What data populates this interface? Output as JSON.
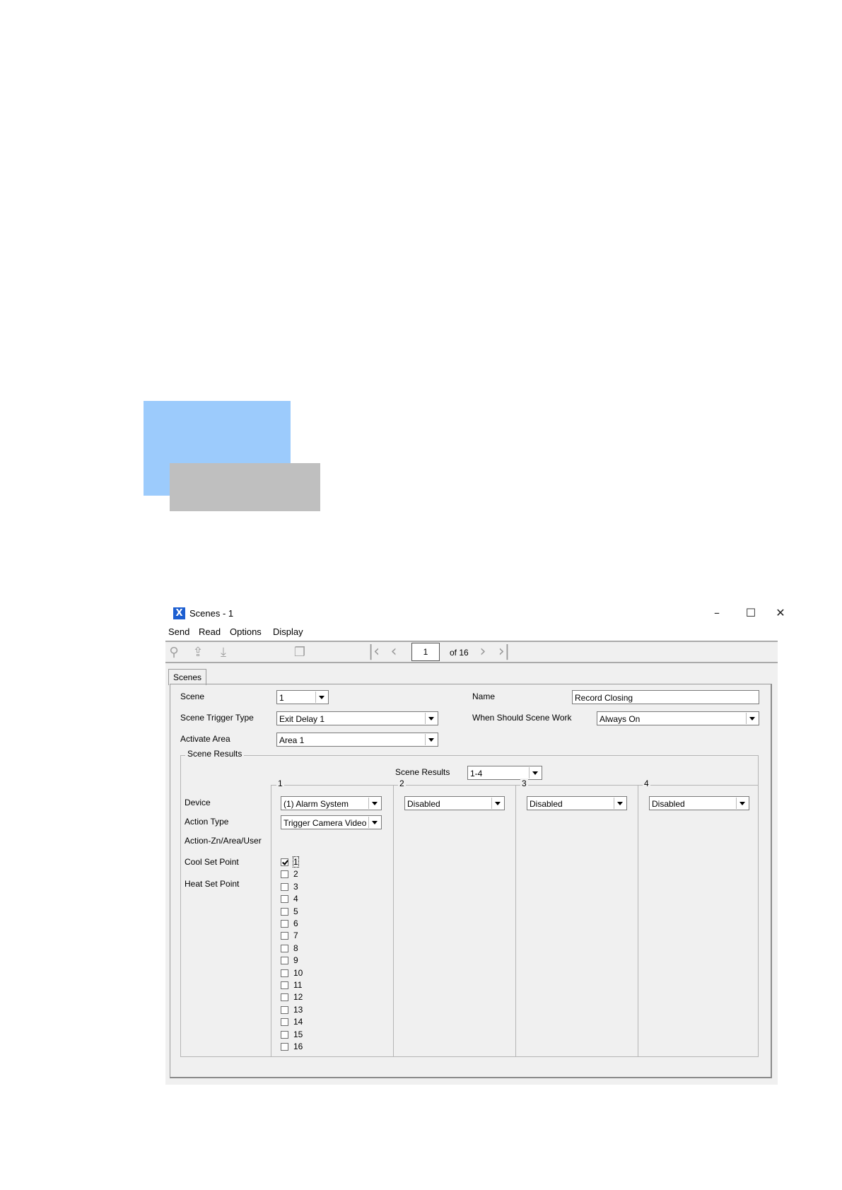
{
  "window": {
    "title": "Scenes - 1",
    "controls": {
      "minimize": "–",
      "maximize": "☐",
      "close": "✕"
    }
  },
  "menu": [
    "Send",
    "Read",
    "Options",
    "Display"
  ],
  "toolbar": {
    "icons": [
      "search-icon",
      "upload-icon",
      "download-icon",
      "copy-icon"
    ],
    "page_current": "1",
    "page_of": "of 16"
  },
  "tab": {
    "label": "Scenes"
  },
  "form": {
    "scene_label": "Scene",
    "scene_value": "1",
    "trigger_label": "Scene Trigger Type",
    "trigger_value": "Exit Delay 1",
    "area_label": "Activate Area",
    "area_value": "Area 1",
    "name_label": "Name",
    "name_value": "Record Closing",
    "when_label": "When Should Scene Work",
    "when_value": "Always On"
  },
  "scene_results": {
    "group_title": "Scene Results",
    "selector_label": "Scene Results",
    "selector_value": "1-4",
    "row_labels": {
      "device": "Device",
      "action_type": "Action Type",
      "action_target": "Action-Zn/Area/User",
      "cool": "Cool Set Point",
      "heat": "Heat Set Point"
    },
    "columns": [
      {
        "number": "1",
        "device": "(1) Alarm System",
        "action_type": "Trigger Camera Video Cl"
      },
      {
        "number": "2",
        "device": "Disabled"
      },
      {
        "number": "3",
        "device": "Disabled"
      },
      {
        "number": "4",
        "device": "Disabled"
      }
    ],
    "checkboxes": [
      {
        "label": "1",
        "checked": true
      },
      {
        "label": "2",
        "checked": false
      },
      {
        "label": "3",
        "checked": false
      },
      {
        "label": "4",
        "checked": false
      },
      {
        "label": "5",
        "checked": false
      },
      {
        "label": "6",
        "checked": false
      },
      {
        "label": "7",
        "checked": false
      },
      {
        "label": "8",
        "checked": false
      },
      {
        "label": "9",
        "checked": false
      },
      {
        "label": "10",
        "checked": false
      },
      {
        "label": "11",
        "checked": false
      },
      {
        "label": "12",
        "checked": false
      },
      {
        "label": "13",
        "checked": false
      },
      {
        "label": "14",
        "checked": false
      },
      {
        "label": "15",
        "checked": false
      },
      {
        "label": "16",
        "checked": false
      }
    ]
  },
  "colors": {
    "app_icon": "#1d5fd1",
    "deco_blue": "#9ccbfc",
    "deco_grey": "#bfbfbf",
    "window_bg": "#f0f0f0"
  }
}
